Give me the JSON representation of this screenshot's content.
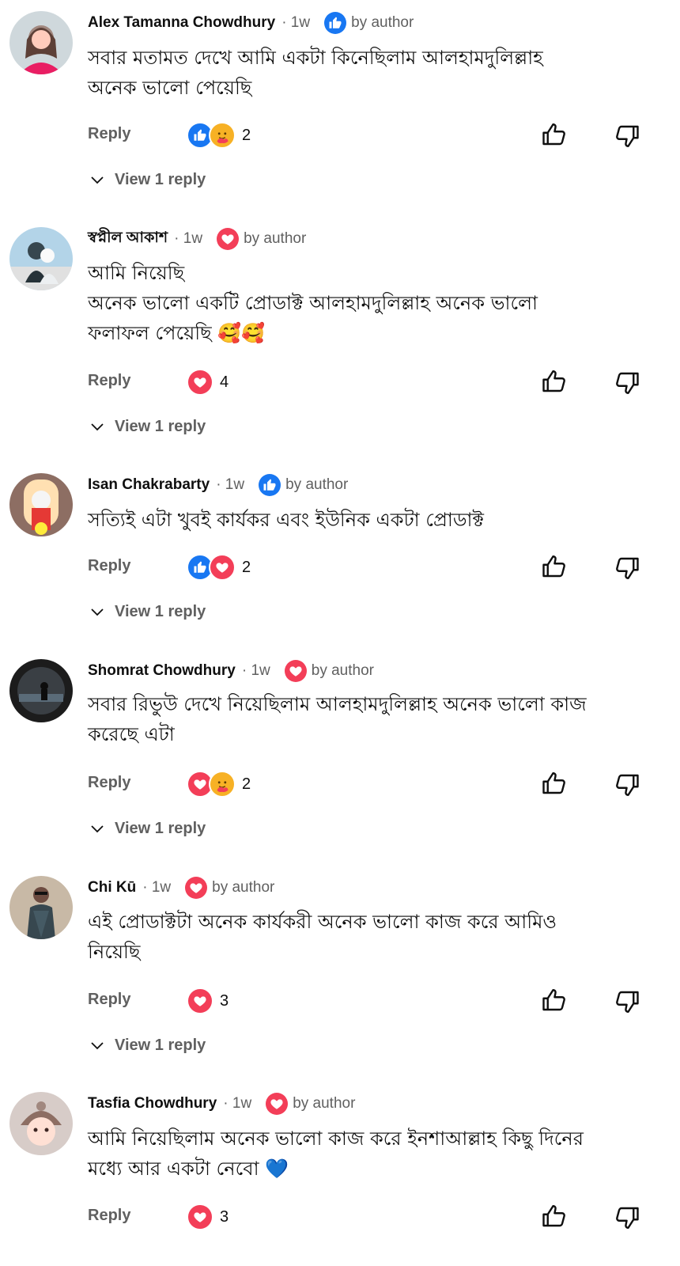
{
  "comments": [
    {
      "author": "Alex Tamanna Chowdhury",
      "time": "· 1w",
      "badge": {
        "type": "like",
        "label": "by author"
      },
      "lines": [
        "সবার মতামত দেখে আমি একটা কিনেছিলাম আলহামদুলিল্লাহ",
        "অনেক ভালো পেয়েছি"
      ],
      "reply_label": "Reply",
      "reactions": [
        "like",
        "care"
      ],
      "reaction_count": "2",
      "view_replies": "View 1 reply"
    },
    {
      "author": "স্বপ্নীল আকাশ",
      "time": "· 1w",
      "badge": {
        "type": "love",
        "label": "by author"
      },
      "lines": [
        "আমি নিয়েছি",
        "অনেক ভালো একটি প্রোডাক্ট আলহামদুলিল্লাহ অনেক ভালো",
        "ফলাফল পেয়েছি 🥰🥰"
      ],
      "reply_label": "Reply",
      "reactions": [
        "love"
      ],
      "reaction_count": "4",
      "view_replies": "View 1 reply"
    },
    {
      "author": "Isan Chakrabarty",
      "time": "· 1w",
      "badge": {
        "type": "like",
        "label": "by author"
      },
      "lines": [
        "সত্যিই এটা খুবই কার্যকর এবং ইউনিক একটা প্রোডাক্ট"
      ],
      "reply_label": "Reply",
      "reactions": [
        "like",
        "love"
      ],
      "reaction_count": "2",
      "view_replies": "View 1 reply"
    },
    {
      "author": "Shomrat Chowdhury",
      "time": "· 1w",
      "badge": {
        "type": "love",
        "label": "by author"
      },
      "lines": [
        "সবার রিভুউ দেখে নিয়েছিলাম আলহামদুলিল্লাহ অনেক ভালো কাজ",
        "করেছে এটা"
      ],
      "reply_label": "Reply",
      "reactions": [
        "love",
        "care"
      ],
      "reaction_count": "2",
      "view_replies": "View 1 reply"
    },
    {
      "author": "Chi Kū",
      "time": "· 1w",
      "badge": {
        "type": "love",
        "label": "by author"
      },
      "lines": [
        "এই প্রোডাক্টটা অনেক কার্যকরী অনেক ভালো কাজ করে আমিও",
        "নিয়েছি"
      ],
      "reply_label": "Reply",
      "reactions": [
        "love"
      ],
      "reaction_count": "3",
      "view_replies": "View 1 reply"
    },
    {
      "author": "Tasfia Chowdhury",
      "time": "· 1w",
      "badge": {
        "type": "love",
        "label": "by author"
      },
      "lines": [
        "আমি নিয়েছিলাম অনেক ভালো কাজ করে ইনশাআল্লাহ কিছু দিনের",
        "মধ্যে আর একটা নেবো 💙"
      ],
      "reply_label": "Reply",
      "reactions": [
        "love"
      ],
      "reaction_count": "3",
      "view_replies": ""
    }
  ],
  "icons": {
    "like_badge": "thumbs-up-icon",
    "love_badge": "heart-icon",
    "care_reaction": "hugging-face-icon",
    "like_action": "thumb-up-icon",
    "dislike_action": "thumb-down-icon",
    "expand": "chevron-down-icon"
  },
  "colors": {
    "like_blue": "#1877f2",
    "love_red": "#f33e58",
    "care_yellow": "#f7b125",
    "muted_text": "#606060"
  }
}
